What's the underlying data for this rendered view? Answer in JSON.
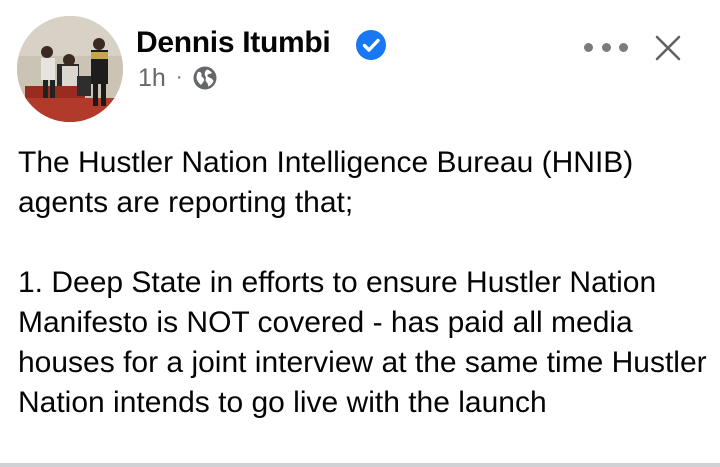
{
  "post": {
    "author": "Dennis Itumbi",
    "verified": true,
    "timestamp": "1h",
    "separator": "·",
    "audience_icon": "globe-icon",
    "menu_icon": "more-horizontal-icon",
    "close_icon": "close-icon",
    "paragraphs": [
      "The Hustler Nation Intelligence Bureau (HNIB) agents are reporting that;",
      "1. Deep State in efforts to ensure Hustler Nation Manifesto is NOT covered - has paid all media houses for a joint interview at the same time Hustler Nation intends to go live with the launch"
    ]
  },
  "colors": {
    "verified_blue": "#1877f2",
    "meta_grey": "#65676b",
    "text": "#050505"
  }
}
